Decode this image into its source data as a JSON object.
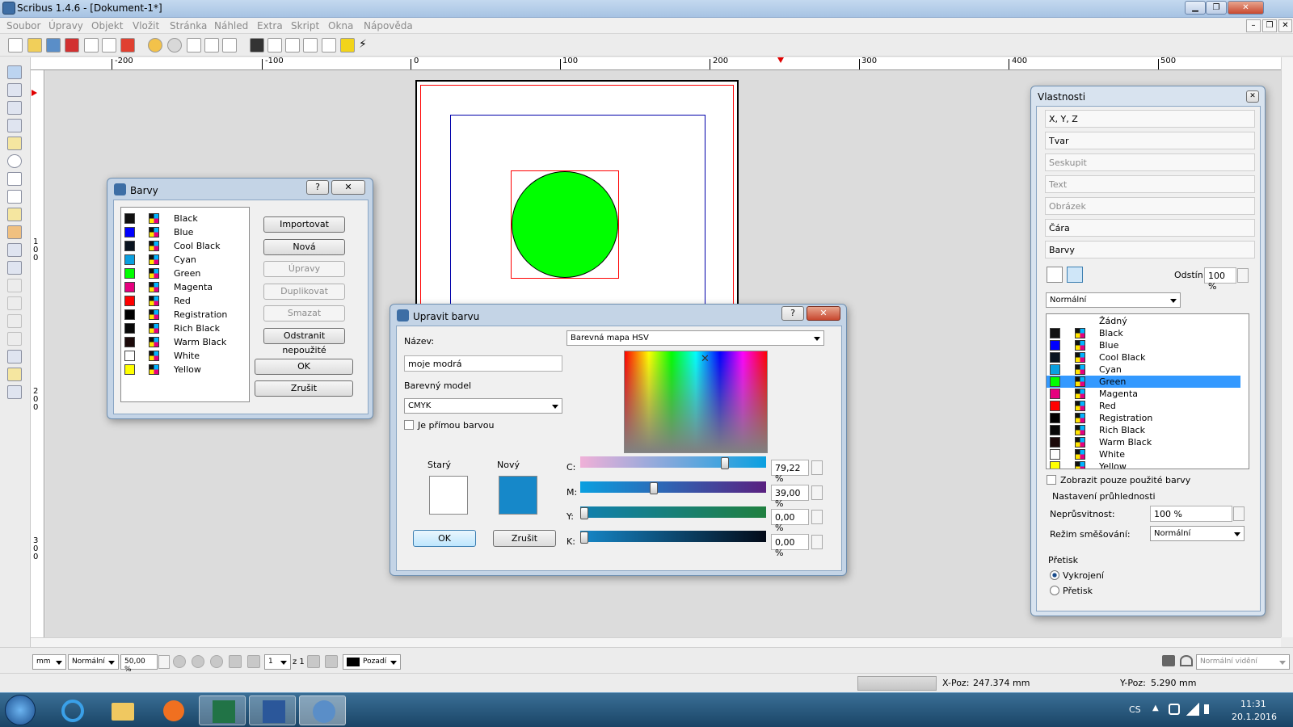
{
  "window": {
    "title": "Scribus 1.4.6 - [Dokument-1*]",
    "controls": {
      "minimize": "▁",
      "maximize": "❐",
      "close": "✕"
    },
    "mdi_controls": {
      "minimize": "–",
      "restore": "❐",
      "close": "✕"
    }
  },
  "menu": [
    "Soubor",
    "Úpravy",
    "Objekt",
    "Vložit",
    "Stránka",
    "Náhled",
    "Extra",
    "Skript",
    "Okna",
    "Nápověda"
  ],
  "toolbar_icons": [
    "new-doc-icon",
    "open-icon",
    "save-icon",
    "close-doc-icon",
    "print-icon",
    "preflight-icon",
    "pdf-export-icon",
    "undo-icon",
    "redo-icon",
    "cut-icon",
    "copy-icon",
    "paste-icon",
    "ok-icon",
    "text-tool-icon",
    "checkbox-icon",
    "list-icon",
    "combo-icon",
    "note-icon",
    "link-icon"
  ],
  "ruler": {
    "h_labels": [
      "-200",
      "-100",
      "0",
      "100",
      "200",
      "300",
      "400",
      "500"
    ],
    "v_labels": [
      "1\n0\n0",
      "2\n0\n0",
      "3\n0\n0"
    ]
  },
  "colors_dialog": {
    "title": "Barvy",
    "help": "?",
    "close": "✕",
    "items": [
      {
        "name": "Black",
        "color": "#111111"
      },
      {
        "name": "Blue",
        "color": "#0000ff"
      },
      {
        "name": "Cool Black",
        "color": "#0a1420"
      },
      {
        "name": "Cyan",
        "color": "#0aa0e0"
      },
      {
        "name": "Green",
        "color": "#00ff00"
      },
      {
        "name": "Magenta",
        "color": "#e6007e"
      },
      {
        "name": "Red",
        "color": "#ff0000"
      },
      {
        "name": "Registration",
        "color": "#000000"
      },
      {
        "name": "Rich Black",
        "color": "#080808"
      },
      {
        "name": "Warm Black",
        "color": "#1c0a0a"
      },
      {
        "name": "White",
        "color": "#ffffff"
      },
      {
        "name": "Yellow",
        "color": "#ffff00"
      }
    ],
    "buttons": {
      "import": "Importovat",
      "new": "Nová",
      "edit": "Úpravy",
      "duplicate": "Duplikovat",
      "delete": "Smazat",
      "remove_unused": "Odstranit nepoužité",
      "ok": "OK",
      "cancel": "Zrušit"
    }
  },
  "edit_color_dialog": {
    "title": "Upravit barvu",
    "help": "?",
    "close": "✕",
    "name_label": "Název:",
    "name_value": "moje modrá",
    "map_select": "Barevná mapa HSV",
    "model_label": "Barevný model",
    "model_value": "CMYK",
    "spot_label": "Je přímou barvou",
    "old_label": "Starý",
    "new_label": "Nový",
    "old_color": "#ffffff",
    "new_color": "#1688c9",
    "ok": "OK",
    "cancel": "Zrušit",
    "sliders": [
      {
        "label": "C:",
        "value": "79,22 %",
        "fraction": 0.7922
      },
      {
        "label": "M:",
        "value": "39,00 %",
        "fraction": 0.39
      },
      {
        "label": "Y:",
        "value": "0,00 %",
        "fraction": 0.0
      },
      {
        "label": "K:",
        "value": "0,00 %",
        "fraction": 0.0
      }
    ]
  },
  "properties": {
    "title": "Vlastnosti",
    "close": "✕",
    "sections": [
      "X, Y, Z",
      "Tvar",
      "Seskupit",
      "Text",
      "Obrázek",
      "Čára",
      "Barvy"
    ],
    "shade_label": "Odstín:",
    "shade_value": "100 %",
    "mode": "Normální",
    "color_list": [
      {
        "name": "Žádný",
        "color": ""
      },
      {
        "name": "Black",
        "color": "#111111"
      },
      {
        "name": "Blue",
        "color": "#0000ff"
      },
      {
        "name": "Cool Black",
        "color": "#0a1420"
      },
      {
        "name": "Cyan",
        "color": "#0aa0e0"
      },
      {
        "name": "Green",
        "color": "#00ff00",
        "selected": true
      },
      {
        "name": "Magenta",
        "color": "#e6007e"
      },
      {
        "name": "Red",
        "color": "#ff0000"
      },
      {
        "name": "Registration",
        "color": "#000000"
      },
      {
        "name": "Rich Black",
        "color": "#080808"
      },
      {
        "name": "Warm Black",
        "color": "#1c0a0a"
      },
      {
        "name": "White",
        "color": "#ffffff"
      },
      {
        "name": "Yellow",
        "color": "#ffff00"
      }
    ],
    "show_used_label": "Zobrazit pouze použité barvy",
    "transparency_title": "Nastavení průhlednosti",
    "opacity_label": "Neprůsvitnost:",
    "opacity_value": "100 %",
    "blend_label": "Režim směšování:",
    "blend_value": "Normální",
    "overprint_title": "Přetisk",
    "knockout": "Vykrojení",
    "overprint": "Přetisk"
  },
  "bottombar": {
    "unit": "mm",
    "mode": "Normální",
    "zoom": "50,00 %",
    "page": "1",
    "page_of": "z 1",
    "layer": "Pozadí",
    "view": "Normální vidění"
  },
  "status": {
    "xpos_label": "X-Poz:",
    "xpos_value": "247.374 mm",
    "ypos_label": "Y-Poz:",
    "ypos_value": "5.290 mm"
  },
  "taskbar": {
    "lang": "CS",
    "time": "11:31",
    "date": "20.1.2016"
  },
  "accent": {
    "selection": "#3399ff",
    "circle_fill": "#00ff00",
    "margin": "#ff0000",
    "guide": "#0000aa"
  }
}
